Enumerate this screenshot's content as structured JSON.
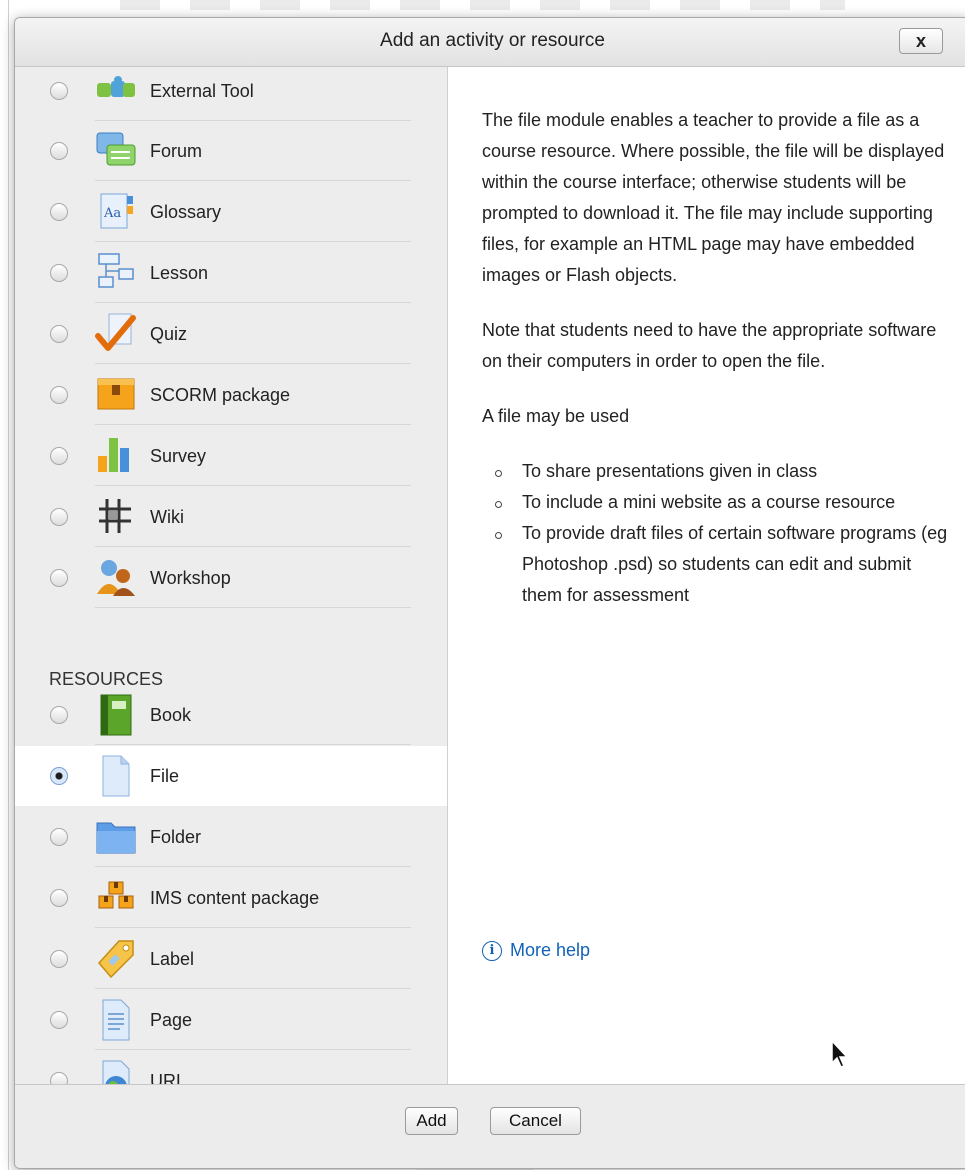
{
  "dialog": {
    "title": "Add an activity or resource",
    "close_label": "x"
  },
  "activities": [
    {
      "label": "External Tool",
      "icon": "puzzle-icon"
    },
    {
      "label": "Forum",
      "icon": "speech-bubbles-icon"
    },
    {
      "label": "Glossary",
      "icon": "glossary-icon"
    },
    {
      "label": "Lesson",
      "icon": "flowchart-icon"
    },
    {
      "label": "Quiz",
      "icon": "checkmark-icon"
    },
    {
      "label": "SCORM package",
      "icon": "package-box-icon"
    },
    {
      "label": "Survey",
      "icon": "bar-chart-icon"
    },
    {
      "label": "Wiki",
      "icon": "wiki-icon"
    },
    {
      "label": "Workshop",
      "icon": "people-icon"
    }
  ],
  "resources_heading": "RESOURCES",
  "resources": [
    {
      "label": "Book",
      "icon": "book-icon",
      "selected": false
    },
    {
      "label": "File",
      "icon": "file-icon",
      "selected": true
    },
    {
      "label": "Folder",
      "icon": "folder-icon",
      "selected": false
    },
    {
      "label": "IMS content package",
      "icon": "boxes-icon",
      "selected": false
    },
    {
      "label": "Label",
      "icon": "tag-icon",
      "selected": false
    },
    {
      "label": "Page",
      "icon": "page-icon",
      "selected": false
    },
    {
      "label": "URL",
      "icon": "globe-icon",
      "selected": false
    }
  ],
  "help": {
    "paragraph1": "The file module enables a teacher to provide a file as a course resource. Where possible, the file will be displayed within the course interface; otherwise students will be prompted to download it. The file may include supporting files, for example an HTML page may have embedded images or Flash objects.",
    "paragraph2": "Note that students need to have the appropriate software on their computers in order to open the file.",
    "paragraph3": "A file may be used",
    "uses": [
      "To share presentations given in class",
      "To include a mini website as a course resource",
      "To provide draft files of certain software programs (eg Photoshop .psd) so students can edit and submit them for assessment"
    ],
    "more_help": "More help"
  },
  "footer": {
    "add_label": "Add",
    "cancel_label": "Cancel"
  }
}
